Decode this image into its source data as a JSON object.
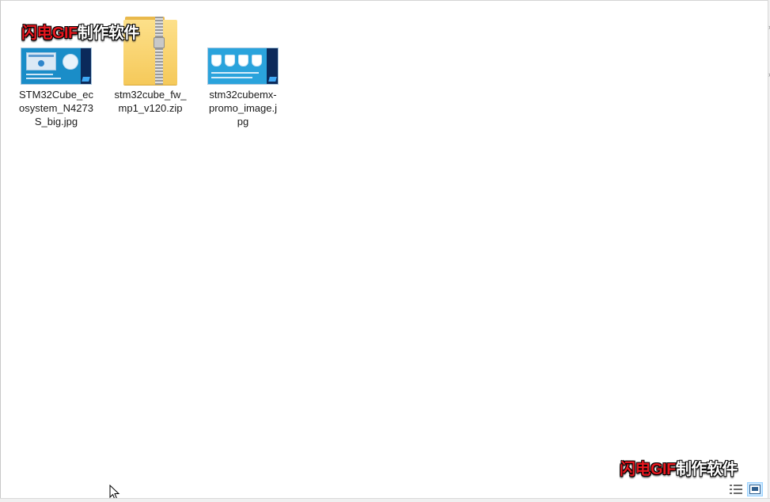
{
  "files": [
    {
      "name": "STM32Cube_ecosystem_N4273S_big.jpg",
      "label_lines": [
        "STM32Cube_ec",
        "osystem_N4273",
        "S_big.jpg"
      ],
      "icon": "image-thumbnail-icon"
    },
    {
      "name": "stm32cube_fw_mp1_v120.zip",
      "label_lines": [
        "stm32cube_fw_",
        "mp1_v120.zip"
      ],
      "icon": "zip-folder-icon"
    },
    {
      "name": "stm32cubemx-promo_image.jpg",
      "label_lines": [
        "stm32cubemx-",
        "promo_image.j",
        "pg"
      ],
      "icon": "image-thumbnail-icon"
    }
  ],
  "watermark": {
    "red_part": "闪电GIF",
    "white_part": "制作软件"
  },
  "view_buttons": [
    {
      "name": "details-view",
      "icon": "details-view-icon",
      "active": false
    },
    {
      "name": "large-icons-view",
      "icon": "large-icons-view-icon",
      "active": true
    }
  ],
  "colors": {
    "accent": "#1a8dc8",
    "watermark_red": "#e8171f",
    "selection": "#cce8ff"
  }
}
